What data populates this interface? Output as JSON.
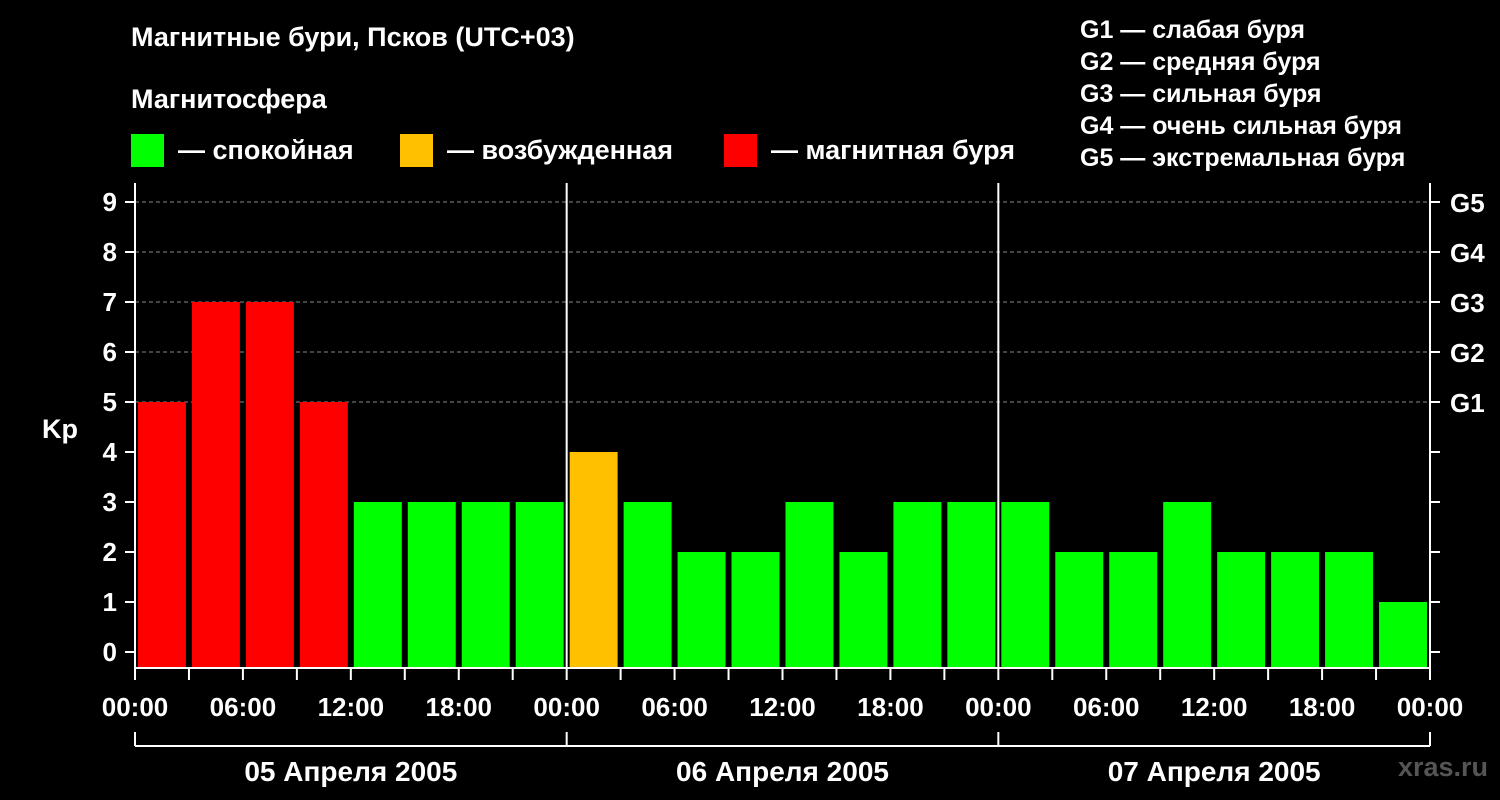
{
  "header": {
    "title": "Магнитные бури, Псков (UTC+03)",
    "subtitle": "Магнитосфера"
  },
  "legend": {
    "items": [
      {
        "label": "— спокойная",
        "color": "#00ff00"
      },
      {
        "label": "— возбужденная",
        "color": "#ffc000"
      },
      {
        "label": "— магнитная буря",
        "color": "#ff0000"
      }
    ]
  },
  "g_legend": [
    "G1 — слабая буря",
    "G2 — средняя буря",
    "G3 — сильная буря",
    "G4 — очень сильная буря",
    "G5 — экстремальная буря"
  ],
  "watermark": "xras.ru",
  "chart_data": {
    "type": "bar",
    "title": "Магнитные бури, Псков (UTC+03)",
    "ylabel": "Kp",
    "ylim": [
      0,
      9
    ],
    "y_ticks": [
      "0",
      "1",
      "2",
      "3",
      "4",
      "5",
      "6",
      "7",
      "8",
      "9"
    ],
    "right_ticks": [
      {
        "value": 5,
        "label": "G1"
      },
      {
        "value": 6,
        "label": "G2"
      },
      {
        "value": 7,
        "label": "G3"
      },
      {
        "value": 8,
        "label": "G4"
      },
      {
        "value": 9,
        "label": "G5"
      }
    ],
    "x_tick_labels": [
      "00:00",
      "06:00",
      "12:00",
      "18:00",
      "00:00",
      "06:00",
      "12:00",
      "18:00",
      "00:00",
      "06:00",
      "12:00",
      "18:00",
      "00:00"
    ],
    "days": [
      "05 Апреля 2005",
      "06 Апреля 2005",
      "07 Апреля 2005"
    ],
    "interval_hours": 3,
    "values": [
      5,
      7,
      7,
      5,
      3,
      3,
      3,
      3,
      4,
      3,
      2,
      2,
      3,
      2,
      3,
      3,
      3,
      2,
      2,
      3,
      2,
      2,
      2,
      1
    ],
    "thresholds": {
      "quiet_max": 3,
      "active": 4,
      "storm_min": 5
    },
    "colors": {
      "quiet": "#00ff00",
      "active": "#ffc000",
      "storm": "#ff0000"
    },
    "grid": true,
    "legend_position": "top"
  }
}
